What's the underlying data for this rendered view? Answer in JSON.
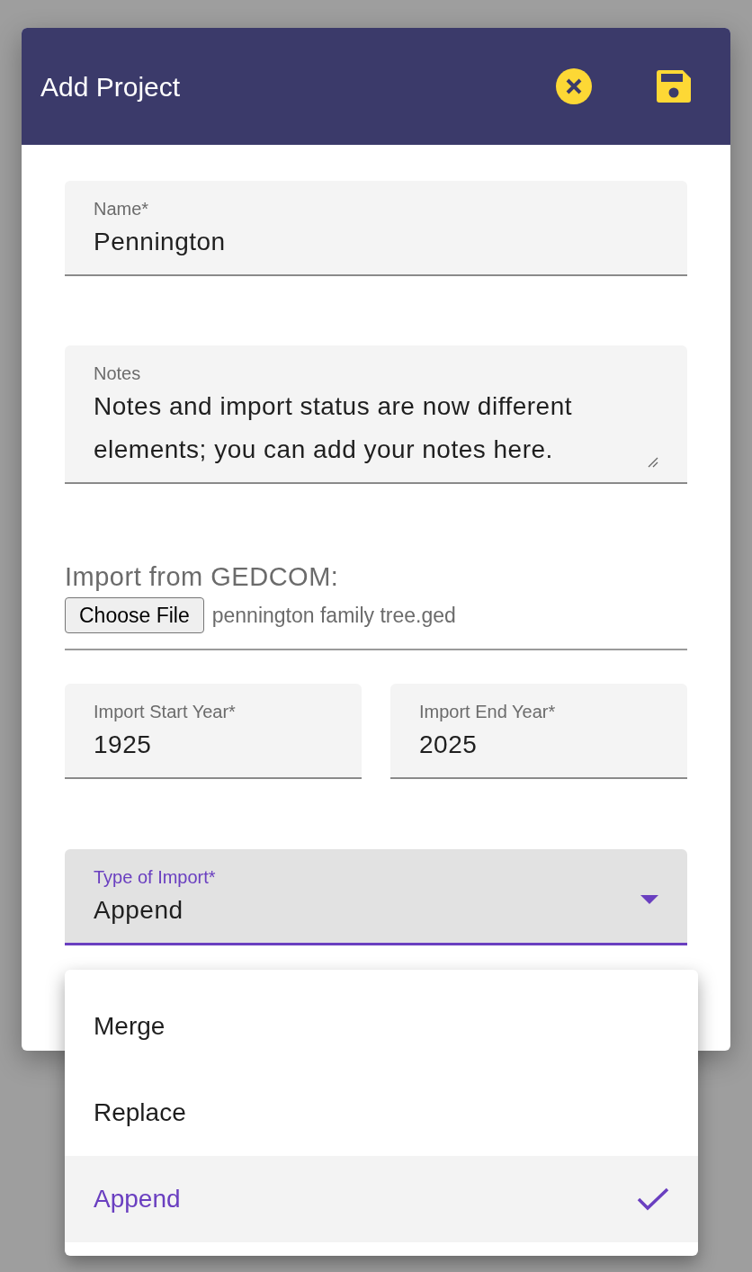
{
  "dialog": {
    "title": "Add Project"
  },
  "fields": [
    {
      "kind": "text",
      "label": "Name*",
      "value": "Pennington"
    },
    {
      "kind": "textarea",
      "label": "Notes",
      "value": "Notes and import status are now different elements; you can add your notes here."
    }
  ],
  "file_import": {
    "label": "Import from GEDCOM:",
    "button": "Choose File",
    "file_name": "pennington family tree.ged"
  },
  "year_fields": [
    {
      "label": "Import Start Year*",
      "value": "1925"
    },
    {
      "label": "Import End Year*",
      "value": "2025"
    }
  ],
  "select": {
    "label": "Type of Import*",
    "value": "Append",
    "expanded": true
  },
  "menu": {
    "options": [
      {
        "label": "Merge",
        "selected": false
      },
      {
        "label": "Replace",
        "selected": false
      },
      {
        "label": "Append",
        "selected": true
      }
    ]
  }
}
